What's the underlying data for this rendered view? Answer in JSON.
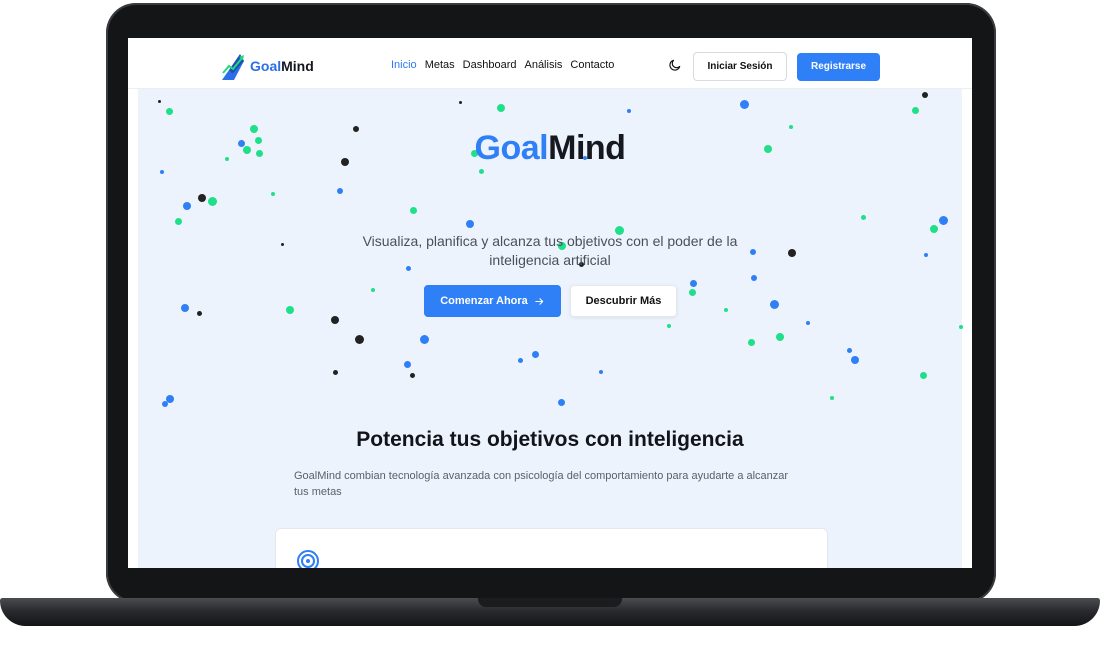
{
  "nav": {
    "logo_prefix": "Goal",
    "logo_suffix": "Mind",
    "links": [
      "Inicio",
      "Metas",
      "Dashboard",
      "Análisis",
      "Contacto"
    ],
    "active_link": "Inicio",
    "login_label": "Iniciar Sesión",
    "register_label": "Registrarse"
  },
  "hero": {
    "title_prefix": "Goal",
    "title_suffix": "Mind",
    "subtitle": "Visualiza, planifica y alcanza tus objetivos con el poder de la inteligencia artificial",
    "start_label": "Comenzar Ahora",
    "discover_label": "Descubrir Más"
  },
  "features": {
    "title": "Potencia tus objetivos con inteligencia",
    "description": "GoalMind combian tecnología avanzada con psicología del comportamiento para ayudarte a alcanzar tus metas"
  },
  "colors": {
    "accent": "#2f7ff6",
    "particle_green": "#1fe089",
    "particle_dark": "#222222",
    "hero_background": "#edf3fd"
  },
  "icons": {
    "logo": "goalmind-logo-icon",
    "theme": "moon-icon",
    "start_arrow": "arrow-right-icon",
    "card": "target-icon"
  }
}
